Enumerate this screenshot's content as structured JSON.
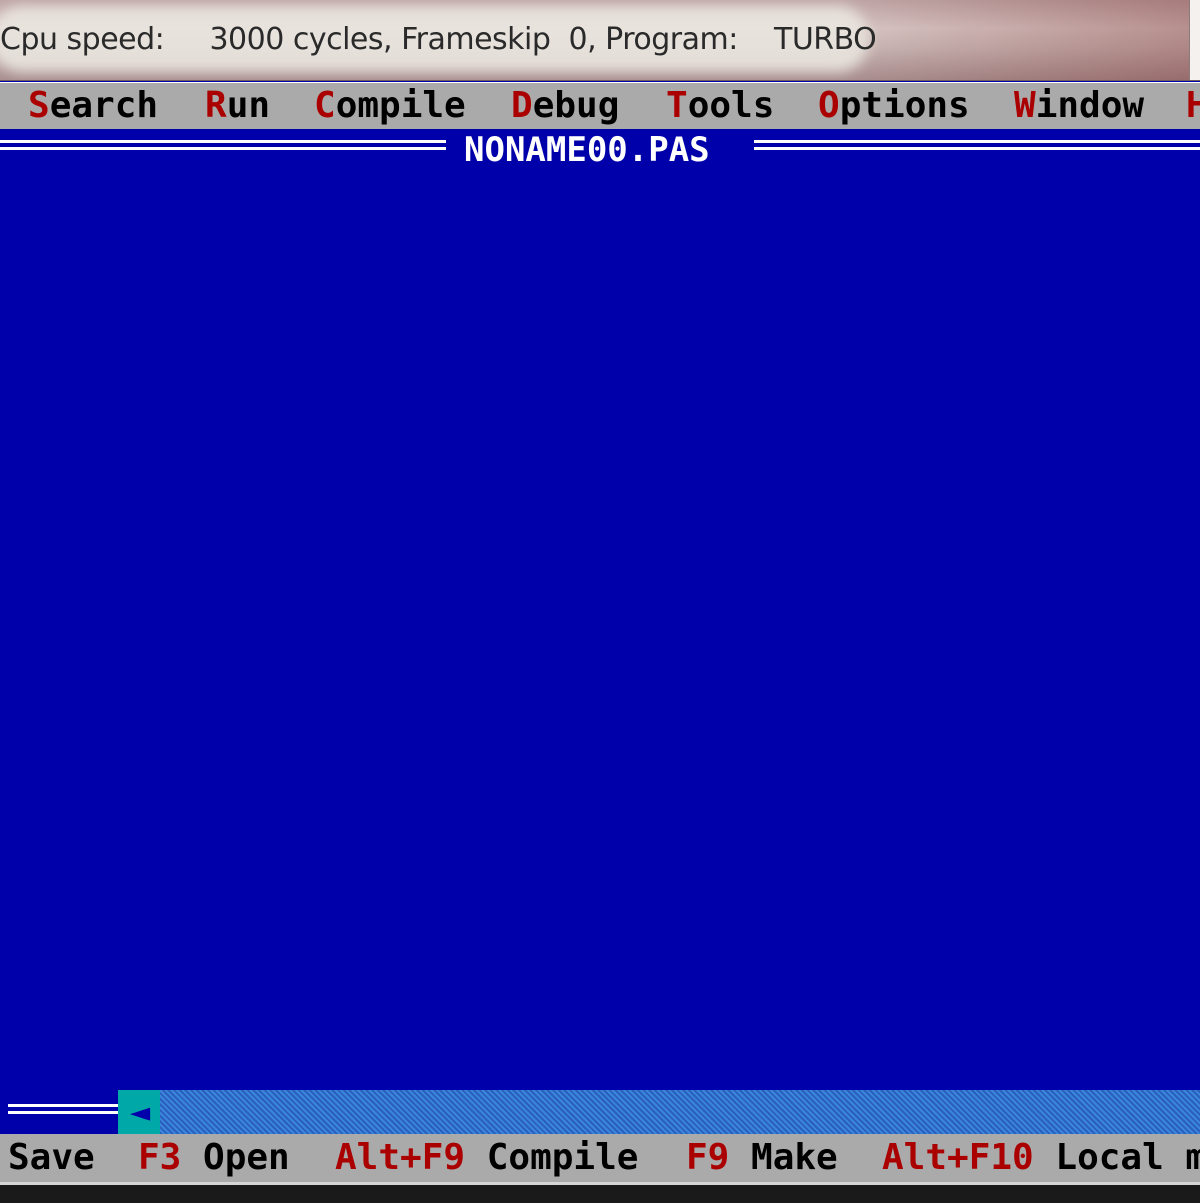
{
  "titlebar": {
    "text": "Cpu speed:     3000 cycles, Frameskip  0, Program:    TURBO"
  },
  "menu": {
    "items": [
      {
        "hot": "S",
        "rest": "earch"
      },
      {
        "hot": "R",
        "rest": "un"
      },
      {
        "hot": "C",
        "rest": "ompile"
      },
      {
        "hot": "D",
        "rest": "ebug"
      },
      {
        "hot": "T",
        "rest": "ools"
      },
      {
        "hot": "O",
        "rest": "ptions"
      },
      {
        "hot": "W",
        "rest": "indow"
      },
      {
        "hot": "H",
        "rest": ""
      }
    ]
  },
  "editor": {
    "filename": "NONAME00.PAS"
  },
  "statusbar": {
    "items": [
      {
        "key": "",
        "label": "Save"
      },
      {
        "key": "F3",
        "label": " Open"
      },
      {
        "key": "Alt+F9",
        "label": " Compile"
      },
      {
        "key": "F9",
        "label": " Make"
      },
      {
        "key": "Alt+F10",
        "label": " Local m"
      }
    ]
  },
  "colors": {
    "editor_bg": "#0000aa",
    "menu_bg": "#aaaaaa",
    "hotkey": "#aa0000",
    "scroll_arrow": "#00a8a8"
  },
  "icons": {
    "scroll_left": "scroll-left-arrow-icon"
  }
}
